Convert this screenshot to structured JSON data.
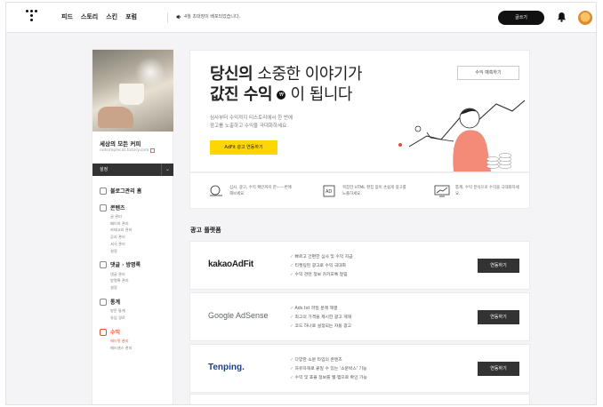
{
  "topbar": {
    "nav": [
      "피드",
      "스토리",
      "스킨",
      "포럼"
    ],
    "notice": "4월 초대장이 배포되었습니다.",
    "write_label": "글쓰기"
  },
  "sidebar": {
    "blog_title": "세상의 모든 커피",
    "blog_url": "notsimplecat.tistory.com",
    "settings_label": "설정",
    "groups": [
      {
        "title": "블로그관리 홈",
        "items": []
      },
      {
        "title": "콘텐츠",
        "items": [
          "글 관리",
          "페이지 관리",
          "카테고리 관리",
          "공지 관리",
          "서식 관리",
          "설정"
        ]
      },
      {
        "title": "댓글 · 방명록",
        "items": [
          "댓글 관리",
          "방명록 관리",
          "설정"
        ]
      },
      {
        "title": "통계",
        "items": [
          "방문 통계",
          "유입 경로"
        ]
      },
      {
        "title": "수익",
        "items": [
          "애드핏 관리",
          "애드센스 관리"
        ]
      }
    ]
  },
  "hero": {
    "line1_bold": "당신의",
    "line1_rest": " 소중한 이야기가",
    "line2_bold": "값진 수익",
    "won_symbol": "₩",
    "line2_rest": " 이 됩니다",
    "desc_1": "심사부터 수익까지 티스토리에서 한 번에",
    "desc_2": "광고를 노출하고 수익을 극대화하세요.",
    "adfit_button": "AdFit 광고 연동하기",
    "calc_button": "수익 예측하기"
  },
  "features": [
    {
      "text": "심사, 광고, 수익 확인까지 한——번에 해보세요."
    },
    {
      "text": "복잡한 HTML 편집 없이 손쉽게 광고를 노출하세요."
    },
    {
      "text": "통계, 수익 분석으로 수익을 극대화하세요."
    }
  ],
  "platforms": {
    "title": "광고 플랫폼",
    "cards": [
      {
        "brand": "kakaoAdFit",
        "lines": [
          "빠르고 간편한 심사 및 수익 지급",
          "티켓팅된 광고로 수익 극대화",
          "수익 관련 정보 카카오톡 알림"
        ],
        "button": "연동하기"
      },
      {
        "brand": "Google AdSense",
        "lines": [
          "Ads.txt 파일 문제 해결",
          "최고의 가격을 제시한 광고 게재",
          "코드 하나로 설정되는 자동 광고"
        ],
        "button": "연동하기"
      },
      {
        "brand": "Tenping.",
        "lines": [
          "다양한 소문 타입의 콘텐츠",
          "자유자재로 붙일 수 있는 '소문박스' 기능",
          "수익 및 효율 정보를 웹·앱으로 확인 가능"
        ],
        "button": "연동하기"
      }
    ]
  }
}
